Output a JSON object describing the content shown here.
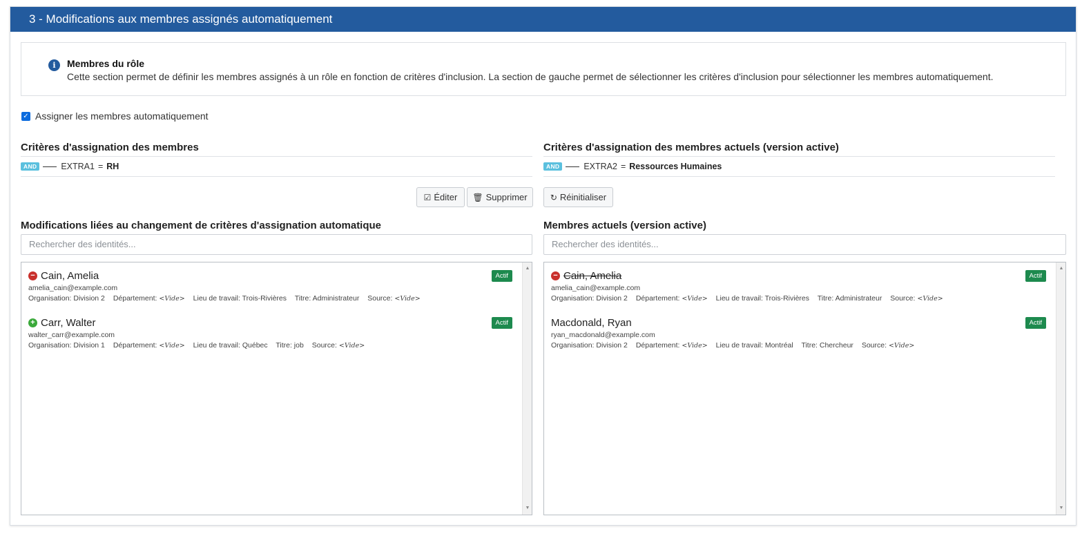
{
  "header": {
    "title": "3 - Modifications aux membres assignés automatiquement"
  },
  "info": {
    "title": "Membres du rôle",
    "text": "Cette section permet de définir les membres assignés à un rôle en fonction de critères d'inclusion. La section de gauche permet de sélectionner les critères d'inclusion pour sélectionner les membres automatiquement."
  },
  "auto_assign": {
    "label": "Assigner les membres automatiquement",
    "checked": true
  },
  "left": {
    "criteria_title": "Critères d'assignation des membres",
    "criteria": {
      "operator": "AND",
      "field": "EXTRA1",
      "comparison": "=",
      "value": "RH"
    },
    "edit_label": "Éditer",
    "delete_label": "Supprimer",
    "members_title": "Modifications liées au changement de critères d'assignation automatique",
    "search_placeholder": "Rechercher des identités...",
    "members": [
      {
        "status": "remove",
        "name": "Cain, Amelia",
        "email": "amelia_cain@example.com",
        "organisation": "Organisation: Division 2",
        "departement_label": "Département:",
        "departement": "<Vide>",
        "lieu": "Lieu de travail: Trois-Rivières",
        "titre": "Titre: Administrateur",
        "source_label": "Source:",
        "source": "<Vide>",
        "badge": "Actif"
      },
      {
        "status": "add",
        "name": "Carr, Walter",
        "email": "walter_carr@example.com",
        "organisation": "Organisation: Division 1",
        "departement_label": "Département:",
        "departement": "<Vide>",
        "lieu": "Lieu de travail: Québec",
        "titre": "Titre: job",
        "source_label": "Source:",
        "source": "<Vide>",
        "badge": "Actif"
      }
    ]
  },
  "right": {
    "criteria_title": "Critères d'assignation des membres actuels (version active)",
    "criteria": {
      "operator": "AND",
      "field": "EXTRA2",
      "comparison": "=",
      "value": "Ressources Humaines"
    },
    "reset_label": "Réinitialiser",
    "members_title": "Membres actuels (version active)",
    "search_placeholder": "Rechercher des identités...",
    "members": [
      {
        "status": "remove",
        "name": "Cain, Amelia",
        "email": "amelia_cain@example.com",
        "organisation": "Organisation: Division 2",
        "departement_label": "Département:",
        "departement": "<Vide>",
        "lieu": "Lieu de travail: Trois-Rivières",
        "titre": "Titre: Administrateur",
        "source_label": "Source:",
        "source": "<Vide>",
        "badge": "Actif"
      },
      {
        "status": "none",
        "name": "Macdonald, Ryan",
        "email": "ryan_macdonald@example.com",
        "organisation": "Organisation: Division 2",
        "departement_label": "Département:",
        "departement": "<Vide>",
        "lieu": "Lieu de travail: Montréal",
        "titre": "Titre: Chercheur",
        "source_label": "Source:",
        "source": "<Vide>",
        "badge": "Actif"
      }
    ]
  },
  "icons": {
    "info": "info-icon",
    "edit": "edit-icon",
    "delete": "trash-icon",
    "reset": "refresh-icon",
    "remove": "minus-circle-icon",
    "add": "plus-circle-icon"
  },
  "colors": {
    "header_bg": "#235b9e",
    "and_badge": "#5bc0de",
    "actif_badge": "#1d8a4e",
    "remove": "#c9302c",
    "add": "#3aa93a"
  }
}
